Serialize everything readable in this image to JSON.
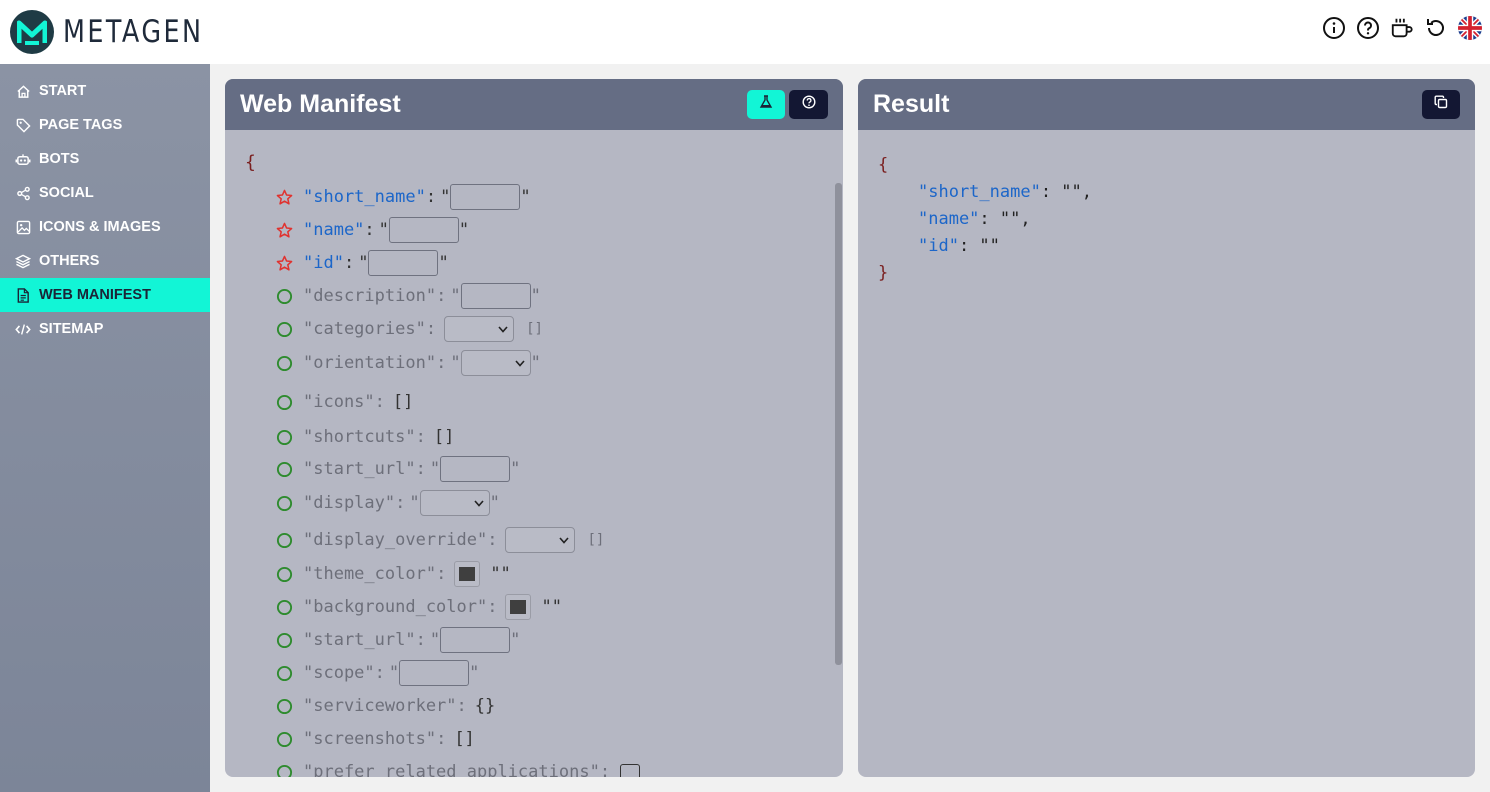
{
  "app": {
    "logo_text": "METAGEN"
  },
  "header": {
    "icons": [
      "info-icon",
      "help-icon",
      "coffee-icon",
      "reset-icon",
      "uk-flag-icon"
    ],
    "colors": {
      "brand_dark": "#1f3b45",
      "accent": "#12f5d6"
    }
  },
  "sidebar": {
    "items": [
      {
        "label": "START",
        "icon": "home-icon"
      },
      {
        "label": "PAGE TAGS",
        "icon": "tag-icon"
      },
      {
        "label": "BOTS",
        "icon": "robot-icon"
      },
      {
        "label": "SOCIAL",
        "icon": "share-icon"
      },
      {
        "label": "ICONS & IMAGES",
        "icon": "image-icon"
      },
      {
        "label": "OTHERS",
        "icon": "layers-icon"
      },
      {
        "label": "WEB MANIFEST",
        "icon": "document-icon",
        "active": true
      },
      {
        "label": "SITEMAP",
        "icon": "code-icon"
      }
    ]
  },
  "editor": {
    "title": "Web Manifest",
    "open_brace": "{",
    "fields": [
      {
        "key": "\"short_name\"",
        "required": true,
        "type": "text"
      },
      {
        "key": "\"name\"",
        "required": true,
        "type": "text"
      },
      {
        "key": "\"id\"",
        "required": true,
        "type": "text"
      },
      {
        "key": "\"description\"",
        "required": false,
        "type": "text"
      },
      {
        "key": "\"categories\"",
        "required": false,
        "type": "select-array",
        "suffix": "[]"
      },
      {
        "key": "\"orientation\"",
        "required": false,
        "type": "select"
      },
      {
        "key": "\"icons\"",
        "required": false,
        "type": "array",
        "suffix": "[]"
      },
      {
        "key": "\"shortcuts\"",
        "required": false,
        "type": "array",
        "suffix": "[]"
      },
      {
        "key": "\"start_url\"",
        "required": false,
        "type": "text"
      },
      {
        "key": "\"display\"",
        "required": false,
        "type": "select"
      },
      {
        "key": "\"display_override\"",
        "required": false,
        "type": "select-array",
        "suffix": "[]"
      },
      {
        "key": "\"theme_color\"",
        "required": false,
        "type": "color",
        "suffix": "\"\""
      },
      {
        "key": "\"background_color\"",
        "required": false,
        "type": "color",
        "suffix": "\"\""
      },
      {
        "key": "\"start_url\"",
        "required": false,
        "type": "text"
      },
      {
        "key": "\"scope\"",
        "required": false,
        "type": "text"
      },
      {
        "key": "\"serviceworker\"",
        "required": false,
        "type": "object",
        "suffix": "{}"
      },
      {
        "key": "\"screenshots\"",
        "required": false,
        "type": "array",
        "suffix": "[]"
      },
      {
        "key": "\"prefer_related_applications\"",
        "required": false,
        "type": "checkbox"
      }
    ]
  },
  "result": {
    "title": "Result",
    "lines": [
      {
        "text": "{",
        "kind": "brace"
      },
      {
        "key": "\"short_name\"",
        "value": ": \"\",",
        "kind": "pair"
      },
      {
        "key": "\"name\"",
        "value": ": \"\",",
        "kind": "pair"
      },
      {
        "key": "\"id\"",
        "value": ": \"\"",
        "kind": "pair"
      },
      {
        "text": "}",
        "kind": "brace"
      }
    ]
  }
}
